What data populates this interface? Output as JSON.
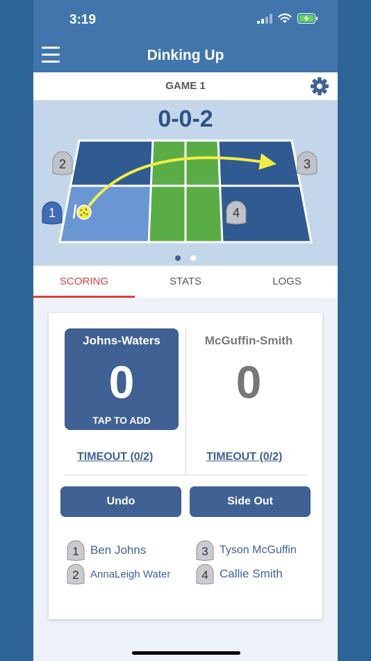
{
  "status_bar": {
    "time": "3:19"
  },
  "nav": {
    "title": "Dinking Up"
  },
  "game": {
    "title": "GAME 1",
    "score_call": "0-0-2"
  },
  "court": {
    "positions": [
      "1",
      "2",
      "3",
      "4"
    ],
    "colors": {
      "court_dark": "#2f5a92",
      "court_light": "#6b96d4",
      "kitchen": "#5aad45",
      "arrow": "#f3ee44",
      "line": "#ffffff"
    }
  },
  "tabs": [
    {
      "label": "SCORING",
      "active": true
    },
    {
      "label": "STATS",
      "active": false
    },
    {
      "label": "LOGS",
      "active": false
    }
  ],
  "teams": [
    {
      "name": "Johns-Waters",
      "score": "0",
      "action": "TAP TO ADD",
      "timeout": "TIMEOUT (0/2)"
    },
    {
      "name": "McGuffin-Smith",
      "score": "0",
      "timeout": "TIMEOUT (0/2)"
    }
  ],
  "buttons": {
    "undo": "Undo",
    "side_out": "Side Out"
  },
  "players": [
    {
      "num": "1",
      "name": "Ben Johns"
    },
    {
      "num": "2",
      "name": "AnnaLeigh Water"
    },
    {
      "num": "3",
      "name": "Tyson McGuffin"
    },
    {
      "num": "4",
      "name": "Callie Smith"
    }
  ],
  "colors": {
    "primary": "#3f6193",
    "header": "#4176ad",
    "accent": "#d9413f"
  }
}
